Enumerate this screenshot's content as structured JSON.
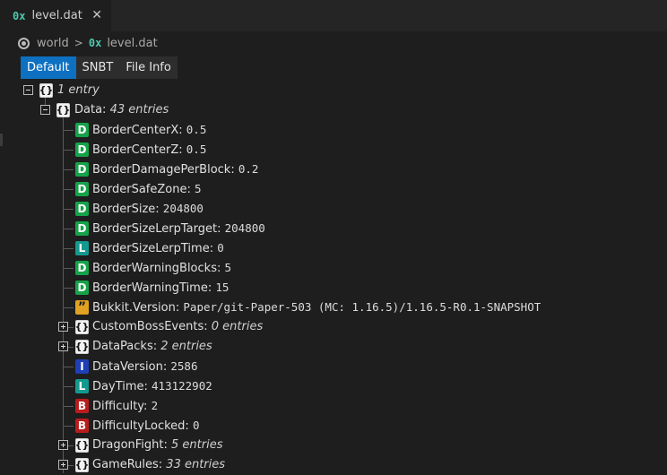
{
  "tab": {
    "icon": "0x",
    "title": "level.dat",
    "close": "✕"
  },
  "breadcrumb": {
    "root": "world",
    "separator": ">",
    "file_icon": "0x",
    "file": "level.dat"
  },
  "view_tabs": [
    "Default",
    "SNBT",
    "File Info"
  ],
  "active_view": "Default",
  "tree": {
    "root": {
      "count_label": "1 entry"
    },
    "data": {
      "key": "Data:",
      "count_label": "43 entries"
    },
    "entries": [
      {
        "type": "D",
        "key": "BorderCenterX:",
        "value": "0.5"
      },
      {
        "type": "D",
        "key": "BorderCenterZ:",
        "value": "0.5"
      },
      {
        "type": "D",
        "key": "BorderDamagePerBlock:",
        "value": "0.2"
      },
      {
        "type": "D",
        "key": "BorderSafeZone:",
        "value": "5"
      },
      {
        "type": "D",
        "key": "BorderSize:",
        "value": "204800"
      },
      {
        "type": "D",
        "key": "BorderSizeLerpTarget:",
        "value": "204800"
      },
      {
        "type": "L",
        "key": "BorderSizeLerpTime:",
        "value": "0"
      },
      {
        "type": "D",
        "key": "BorderWarningBlocks:",
        "value": "5"
      },
      {
        "type": "D",
        "key": "BorderWarningTime:",
        "value": "15"
      },
      {
        "type": "S",
        "key": "Bukkit.Version:",
        "value": "Paper/git-Paper-503 (MC: 1.16.5)/1.16.5-R0.1-SNAPSHOT"
      },
      {
        "type": "C",
        "key": "CustomBossEvents:",
        "meta": "0 entries"
      },
      {
        "type": "C",
        "key": "DataPacks:",
        "meta": "2 entries"
      },
      {
        "type": "I",
        "key": "DataVersion:",
        "value": "2586"
      },
      {
        "type": "L",
        "key": "DayTime:",
        "value": "413122902"
      },
      {
        "type": "B",
        "key": "Difficulty:",
        "value": "2"
      },
      {
        "type": "B",
        "key": "DifficultyLocked:",
        "value": "0"
      },
      {
        "type": "C",
        "key": "DragonFight:",
        "meta": "5 entries"
      },
      {
        "type": "C",
        "key": "GameRules:",
        "meta": "33 entries"
      }
    ]
  },
  "icon_glyphs": {
    "D": "D",
    "L": "L",
    "I": "I",
    "B": "B",
    "S": "”",
    "C": "{}"
  },
  "colors": {
    "D": "#16a34a",
    "L": "#14998f",
    "I": "#1e3fb5",
    "B": "#b91c1c",
    "S": "#e0a222",
    "accent": "#0e70c0"
  }
}
